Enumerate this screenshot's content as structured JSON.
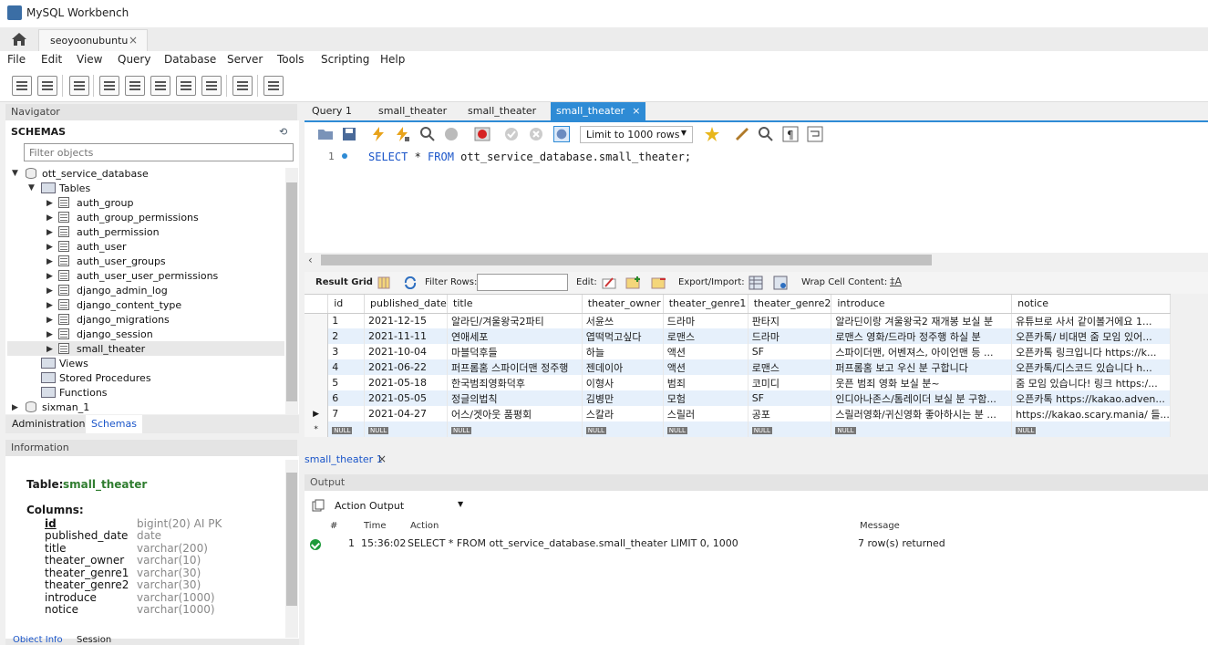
{
  "app_title": "MySQL Workbench",
  "connection_tab": {
    "label": "seoyoonubuntu",
    "close": "×"
  },
  "menu": [
    "File",
    "Edit",
    "View",
    "Query",
    "Database",
    "Server",
    "Tools",
    "Scripting",
    "Help"
  ],
  "navigator": {
    "header": "Navigator",
    "schemas_label": "SCHEMAS",
    "filter_placeholder": "Filter objects",
    "tree": {
      "db1": "ott_service_database",
      "tables_label": "Tables",
      "tables": [
        "auth_group",
        "auth_group_permissions",
        "auth_permission",
        "auth_user",
        "auth_user_groups",
        "auth_user_user_permissions",
        "django_admin_log",
        "django_content_type",
        "django_migrations",
        "django_session",
        "small_theater"
      ],
      "views": "Views",
      "procs": "Stored Procedures",
      "funcs": "Functions",
      "db2": "sixman_1"
    },
    "tabs": [
      "Administration",
      "Schemas"
    ]
  },
  "information": {
    "header": "Information",
    "table_label": "Table:",
    "table_name": "small_theater",
    "columns_label": "Columns:",
    "columns": [
      {
        "name": "id",
        "type": "bigint(20) AI PK"
      },
      {
        "name": "published_date",
        "type": "date"
      },
      {
        "name": "title",
        "type": "varchar(200)"
      },
      {
        "name": "theater_owner",
        "type": "varchar(10)"
      },
      {
        "name": "theater_genre1",
        "type": "varchar(30)"
      },
      {
        "name": "theater_genre2",
        "type": "varchar(30)"
      },
      {
        "name": "introduce",
        "type": "varchar(1000)"
      },
      {
        "name": "notice",
        "type": "varchar(1000)"
      }
    ],
    "bottom_tabs": [
      "Object Info",
      "Session"
    ]
  },
  "query_tabs": [
    "Query 1",
    "small_theater",
    "small_theater",
    "small_theater"
  ],
  "query_tab_close": "×",
  "limit_select": "Limit to 1000 rows",
  "editor": {
    "line": "1",
    "kw1": "SELECT",
    "mid": " * ",
    "kw2": "FROM",
    "rest": " ott_service_database.small_theater;"
  },
  "result_toolbar": {
    "result_grid": "Result Grid",
    "filter_rows": "Filter Rows:",
    "edit": "Edit:",
    "export": "Export/Import:",
    "wrap": "Wrap Cell Content:"
  },
  "grid": {
    "columns": [
      "id",
      "published_date",
      "title",
      "theater_owner",
      "theater_genre1",
      "theater_genre2",
      "introduce",
      "notice"
    ],
    "rows": [
      [
        "1",
        "2021-12-15",
        "알라딘/겨울왕국2파티",
        "서윤쓰",
        "드라마",
        "판타지",
        "알라딘이랑 겨울왕국2 재개봉 보실 분",
        "유튜브로 사서 같이볼거에요 1..."
      ],
      [
        "2",
        "2021-11-11",
        "연애세포",
        "엽떡먹고싶다",
        "로맨스",
        "드라마",
        "로맨스 영화/드라마 정주행 하실 분",
        "오픈카톡/ 비대면 줌 모임 있어..."
      ],
      [
        "3",
        "2021-10-04",
        "마블덕후들",
        "하늘",
        "액션",
        "SF",
        "스파이더맨, 어벤져스, 아이언맨 등 ...",
        "오픈카톡 링크입니다 https://k..."
      ],
      [
        "4",
        "2021-06-22",
        "퍼프롬홈 스파이더맨 정주행",
        "젠데이아",
        "액션",
        "로맨스",
        "퍼프롬홈 보고 우신 분 구합니다",
        "오픈카톡/디스코드 있습니다 h..."
      ],
      [
        "5",
        "2021-05-18",
        "한국범죄영화덕후",
        "이형사",
        "범죄",
        "코미디",
        "웃픈 범죄 영화 보실 분~",
        "줌 모임 있습니다! 링크 https:/..."
      ],
      [
        "6",
        "2021-05-05",
        "정글의법칙",
        "김병만",
        "모험",
        "SF",
        "인디아나존스/톰레이더 보실 분 구함...",
        "오픈카톡 https://kakao.adven..."
      ],
      [
        "7",
        "2021-04-27",
        "어스/겟아웃 품평회",
        "스칼라",
        "스릴러",
        "공포",
        "스릴러영화/귀신영화 좋아하시는 분 ...",
        "https://kakao.scary.mania/ 들..."
      ]
    ],
    "null_label": "NULL",
    "new_row_marker": "*"
  },
  "result_tab": {
    "label": "small_theater 1",
    "close": "×"
  },
  "output": {
    "header": "Output",
    "selector": "Action Output",
    "columns": [
      "#",
      "Time",
      "Action",
      "Message"
    ],
    "rows": [
      {
        "num": "1",
        "time": "15:36:02",
        "action": "SELECT * FROM ott_service_database.small_theater LIMIT 0, 1000",
        "message": "7 row(s) returned"
      }
    ]
  }
}
